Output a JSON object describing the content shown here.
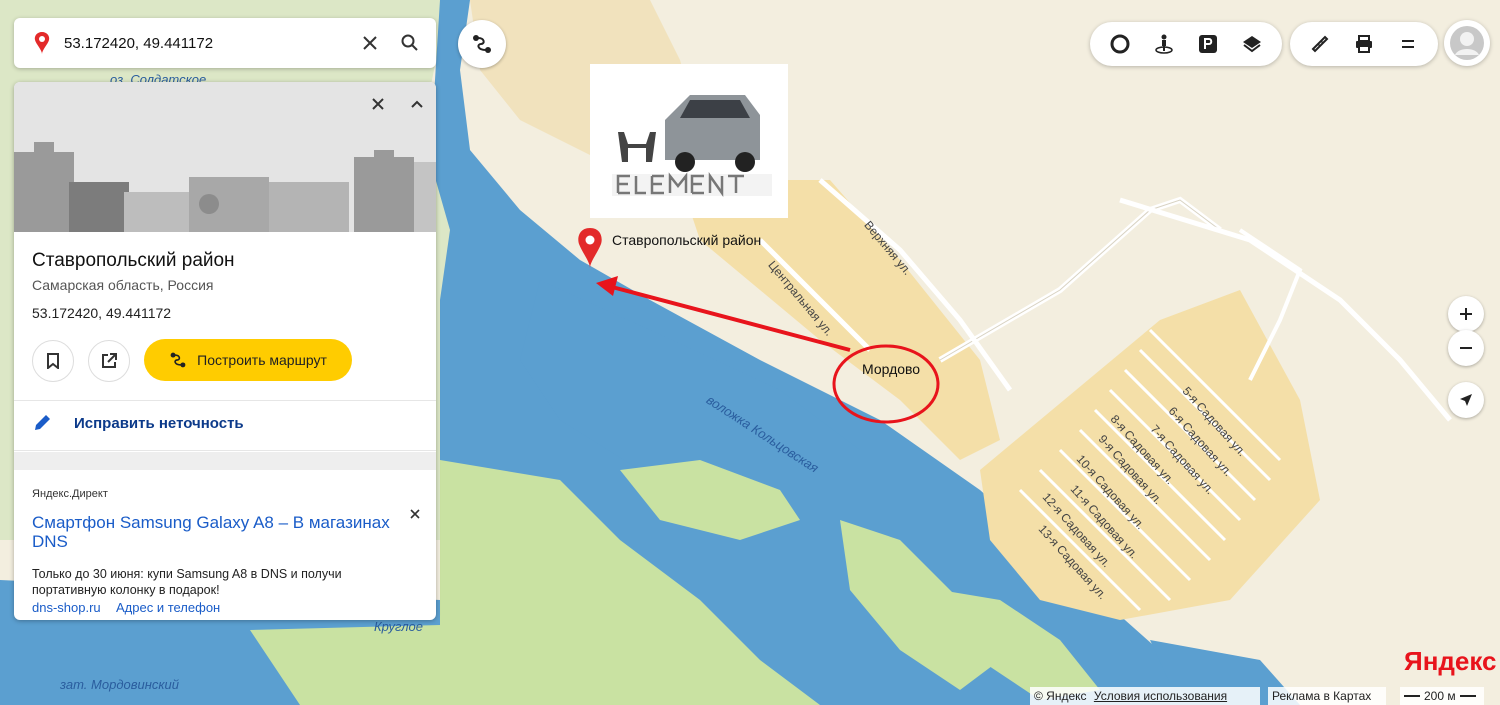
{
  "search": {
    "query": "53.172420, 49.441172"
  },
  "card": {
    "title": "Ставропольский район",
    "subtitle": "Самарская область, Россия",
    "coordinates": "53.172420, 49.441172",
    "route_label": "Построить маршрут",
    "fix_label": "Исправить неточность"
  },
  "ad": {
    "source": "Яндекс.Директ",
    "title": "Смартфон Samsung Galaxy A8 – В магазинах DNS",
    "text": "Только до 30 июня: купи Samsung A8 в DNS и получи портативную колонку в подарок!",
    "link1": "dns-shop.ru",
    "link2": "Адрес и телефон"
  },
  "map": {
    "marker_label": "Ставропольский район",
    "village_label": "Мордово",
    "water_labels": [
      "оз. Солдатское",
      "воложка Кольцовская",
      "Круглое",
      "зат. Мордовинский"
    ],
    "streets": [
      "Верхняя ул.",
      "Центральная ул.",
      "5-я Садовая ул.",
      "6-я Садовая ул.",
      "7-я Садовая ул.",
      "8-я Садовая ул.",
      "9-я Садовая ул.",
      "10-я Садовая ул.",
      "11-я Садовая ул.",
      "12-я Садовая ул.",
      "13-я Садовая ул."
    ],
    "logo_text": "HONDA ELEMENT"
  },
  "footer": {
    "copyright": "© Яндекс",
    "terms": "Условия использования",
    "ads": "Реклама в Картах",
    "scale": "200 м",
    "brand": "Яндекс"
  },
  "colors": {
    "water": "#5b9fd0",
    "land": "#f3eedf",
    "green": "#c9e2a2",
    "residential": "#f4dfa8",
    "accent": "#ffcc00",
    "marker": "#e32a2a"
  }
}
